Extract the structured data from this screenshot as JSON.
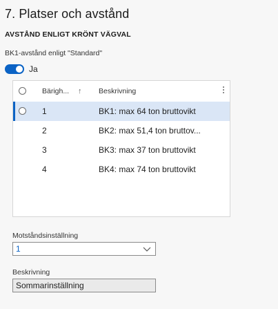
{
  "section": {
    "title": "7. Platser och avstånd"
  },
  "group": {
    "header": "AVSTÅND ENLIGT KRÖNT VÄGVAL"
  },
  "bk1_field": {
    "label": "BK1-avstånd enligt \"Standard\"",
    "toggle_value": "Ja"
  },
  "grid": {
    "columns": {
      "barighet": "Bärigh...",
      "beskrivning": "Beskrivning"
    },
    "rows": [
      {
        "barighet": "1",
        "beskrivning": "BK1: max 64 ton bruttovikt"
      },
      {
        "barighet": "2",
        "beskrivning": "BK2: max 51,4 ton bruttov..."
      },
      {
        "barighet": "3",
        "beskrivning": "BK3: max 37 ton bruttovikt"
      },
      {
        "barighet": "4",
        "beskrivning": "BK4: max 74 ton bruttovikt"
      }
    ]
  },
  "motstand": {
    "label": "Motståndsinställning",
    "value": "1"
  },
  "beskrivning_field": {
    "label": "Beskrivning",
    "value": "Sommarinställning"
  },
  "colors": {
    "accent": "#0b63c5",
    "selected_row": "#dae6f6"
  }
}
